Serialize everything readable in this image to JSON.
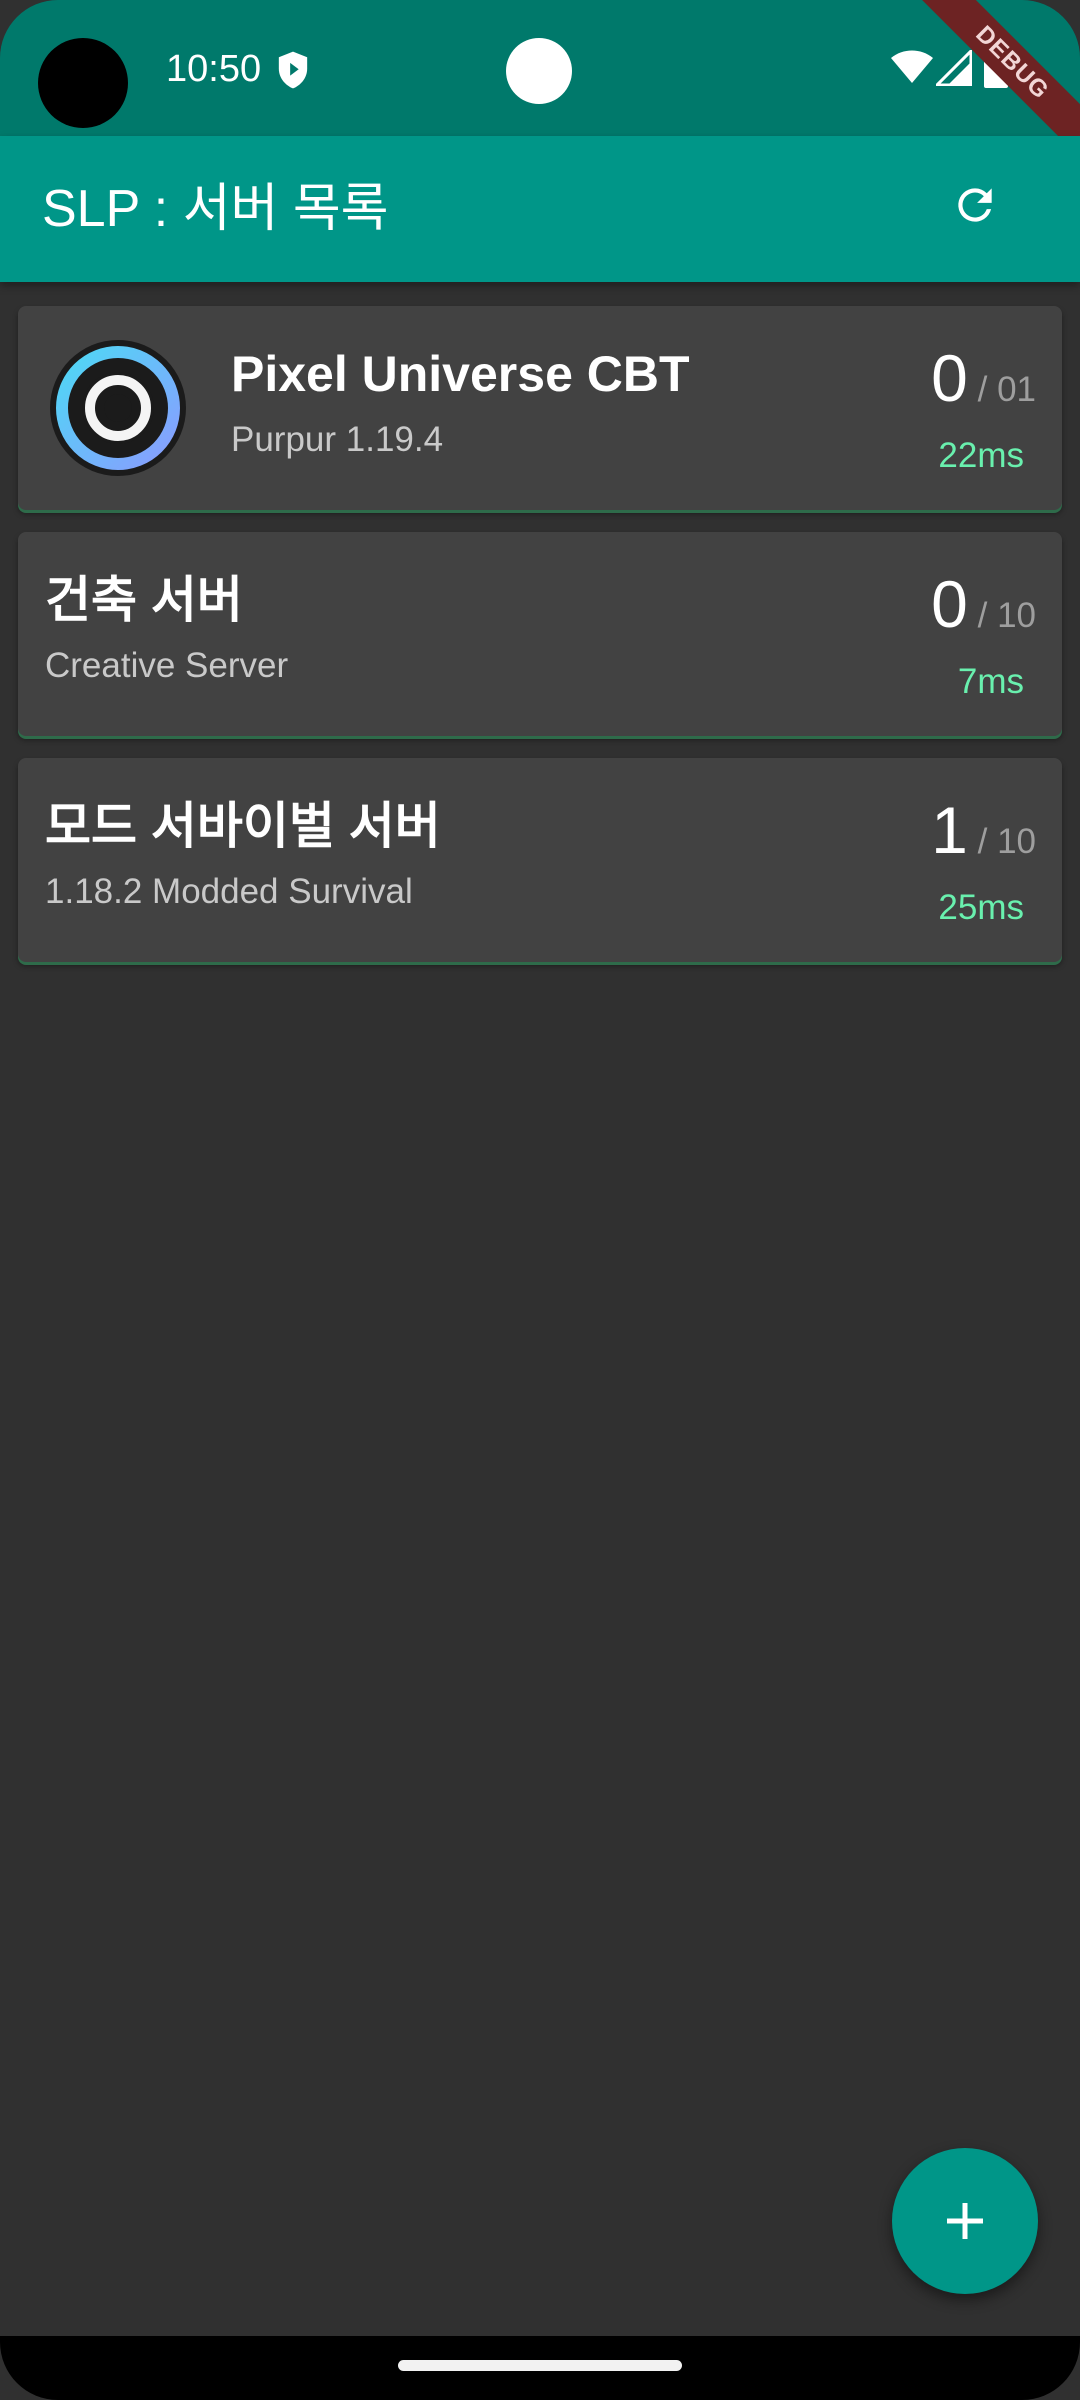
{
  "status_bar": {
    "time": "10:50"
  },
  "debug_banner": {
    "label": "DEBUG"
  },
  "app_bar": {
    "title": "SLP : 서버 목록",
    "refresh_icon": "refresh-icon"
  },
  "servers": [
    {
      "name": "Pixel Universe CBT",
      "description": "Purpur 1.19.4",
      "players_online": "0",
      "players_max": "01",
      "ping": "22ms",
      "has_icon": true
    },
    {
      "name": "건축 서버",
      "description": "Creative Server",
      "players_online": "0",
      "players_max": "10",
      "ping": "7ms",
      "has_icon": false
    },
    {
      "name": "모드 서바이벌 서버",
      "description": "1.18.2 Modded Survival",
      "players_online": "1",
      "players_max": "10",
      "ping": "25ms",
      "has_icon": false
    }
  ],
  "fab": {
    "icon": "plus-icon"
  },
  "colors": {
    "primary": "#009688",
    "primary_dark": "#00796b",
    "background": "#303030",
    "card": "#424242",
    "ping": "#69f0ae"
  }
}
